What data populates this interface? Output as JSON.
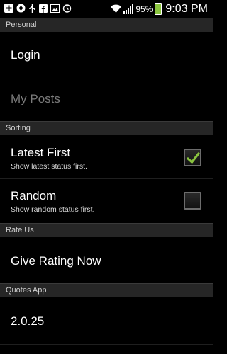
{
  "status_bar": {
    "icons": [
      "plus-icon",
      "sync-icon",
      "usb-icon",
      "facebook-icon",
      "image-icon",
      "alarm-icon",
      "wifi-icon",
      "signal-icon",
      "battery-icon"
    ],
    "battery_percent": "95%",
    "time": "9:03 PM"
  },
  "settings": {
    "personal_header": "Personal",
    "login_title": "Login",
    "my_posts_title": "My Posts",
    "sorting_header": "Sorting",
    "latest_title": "Latest First",
    "latest_summary": "Show latest status first.",
    "latest_checked": true,
    "random_title": "Random",
    "random_summary": "Show random status first.",
    "random_checked": false,
    "rate_header": "Rate Us",
    "rating_title": "Give Rating Now",
    "app_header": "Quotes App",
    "version_title": "2.0.25"
  },
  "colors": {
    "checkmark": "#8ac43f",
    "section_bg": "#262626",
    "disabled_text": "#7b7b7b"
  }
}
